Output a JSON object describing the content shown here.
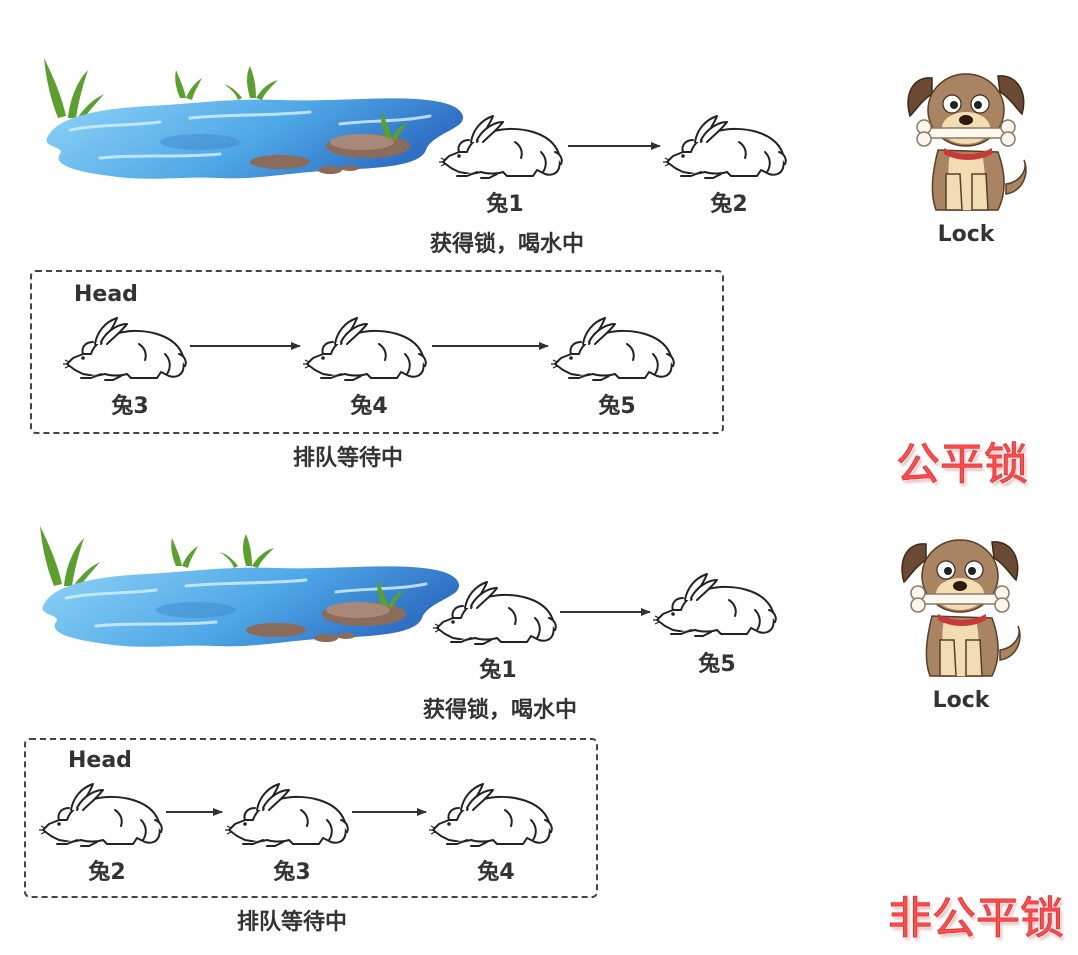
{
  "fair": {
    "title": "公平锁",
    "lock_label": "Lock",
    "drinking_rabbit": "兔1",
    "drinking_caption": "获得锁，喝水中",
    "next_rabbit": "兔2",
    "queue_head": "Head",
    "queue": [
      "兔3",
      "兔4",
      "兔5"
    ],
    "queue_caption": "排队等待中"
  },
  "nonfair": {
    "title": "非公平锁",
    "lock_label": "Lock",
    "drinking_rabbit": "兔1",
    "drinking_caption": "获得锁，喝水中",
    "next_rabbit": "兔5",
    "queue_head": "Head",
    "queue": [
      "兔2",
      "兔3",
      "兔4"
    ],
    "queue_caption": "排队等待中"
  },
  "colors": {
    "title": "#ff4d4d",
    "text": "#333333",
    "water": "#5bb3ea",
    "grass": "#5aa02c",
    "dog": "#a88462"
  },
  "icons": {
    "pond": "pond-illustration",
    "rabbit": "rabbit-drawing",
    "dog": "dog-with-bone-illustration"
  }
}
